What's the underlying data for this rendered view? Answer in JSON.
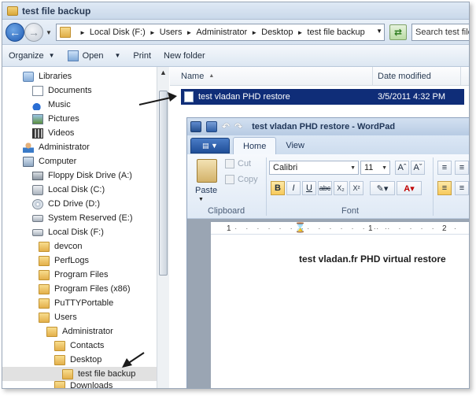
{
  "window": {
    "title": "test file backup"
  },
  "address": {
    "breadcrumbs": [
      "Local Disk (F:)",
      "Users",
      "Administrator",
      "Desktop",
      "test file backup"
    ],
    "search_placeholder": "Search test file backup"
  },
  "command_bar": {
    "organize": "Organize",
    "open": "Open",
    "print": "Print",
    "new_folder": "New folder"
  },
  "tree": [
    {
      "label": "Libraries",
      "icon": "library-icon"
    },
    {
      "label": "Documents",
      "icon": "document-icon"
    },
    {
      "label": "Music",
      "icon": "music-icon"
    },
    {
      "label": "Pictures",
      "icon": "pictures-icon"
    },
    {
      "label": "Videos",
      "icon": "videos-icon"
    },
    {
      "label": "Administrator",
      "icon": "user-icon"
    },
    {
      "label": "Computer",
      "icon": "computer-icon"
    },
    {
      "label": "Floppy Disk Drive (A:)",
      "icon": "floppy-icon"
    },
    {
      "label": "Local Disk (C:)",
      "icon": "system-disk-icon"
    },
    {
      "label": "CD Drive (D:)",
      "icon": "cd-drive-icon"
    },
    {
      "label": "System Reserved (E:)",
      "icon": "disk-icon"
    },
    {
      "label": "Local Disk (F:)",
      "icon": "disk-icon"
    },
    {
      "label": "devcon",
      "icon": "folder-icon"
    },
    {
      "label": "PerfLogs",
      "icon": "folder-icon"
    },
    {
      "label": "Program Files",
      "icon": "folder-icon"
    },
    {
      "label": "Program Files (x86)",
      "icon": "folder-icon"
    },
    {
      "label": "PuTTYPortable",
      "icon": "folder-icon"
    },
    {
      "label": "Users",
      "icon": "folder-icon"
    },
    {
      "label": "Administrator",
      "icon": "folder-icon"
    },
    {
      "label": "Contacts",
      "icon": "folder-icon"
    },
    {
      "label": "Desktop",
      "icon": "folder-icon"
    },
    {
      "label": "test file backup",
      "icon": "folder-icon"
    },
    {
      "label": "Downloads",
      "icon": "folder-icon"
    }
  ],
  "file_list": {
    "columns": {
      "name": "Name",
      "date": "Date modified"
    },
    "rows": [
      {
        "name": "test vladan PHD restore",
        "date": "3/5/2011 4:32 PM"
      }
    ]
  },
  "wordpad": {
    "title": "test vladan PHD restore - WordPad",
    "tabs": {
      "home": "Home",
      "view": "View"
    },
    "clipboard": {
      "paste": "Paste",
      "cut": "Cut",
      "copy": "Copy",
      "group_label": "Clipboard"
    },
    "font": {
      "family": "Calibri",
      "size": "11",
      "group_label": "Font"
    },
    "ruler": [
      "1",
      "1",
      "1",
      "2"
    ],
    "document_text": "test vladan.fr PHD virtual restore"
  },
  "colors": {
    "selection": "#0f2d78",
    "accent": "#1f5bb3"
  }
}
